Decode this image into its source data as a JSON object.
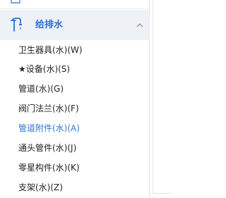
{
  "sidebar": {
    "section": {
      "title": "给排水",
      "icon": "faucet-icon",
      "expanded": true,
      "accent_color": "#2f6fd0"
    },
    "items": [
      {
        "label": "卫生器具(水)(W)",
        "active": false
      },
      {
        "label": "★设备(水)(S)",
        "active": false
      },
      {
        "label": "管道(水)(G)",
        "active": false
      },
      {
        "label": "阀门法兰(水)(F)",
        "active": false
      },
      {
        "label": "管道附件(水)(A)",
        "active": true
      },
      {
        "label": "通头管件(水)(J)",
        "active": false
      },
      {
        "label": "零星构件(水)(K)",
        "active": false
      },
      {
        "label": "支架(水)(Z)",
        "active": false
      }
    ],
    "active_color": "#2f78d4"
  }
}
